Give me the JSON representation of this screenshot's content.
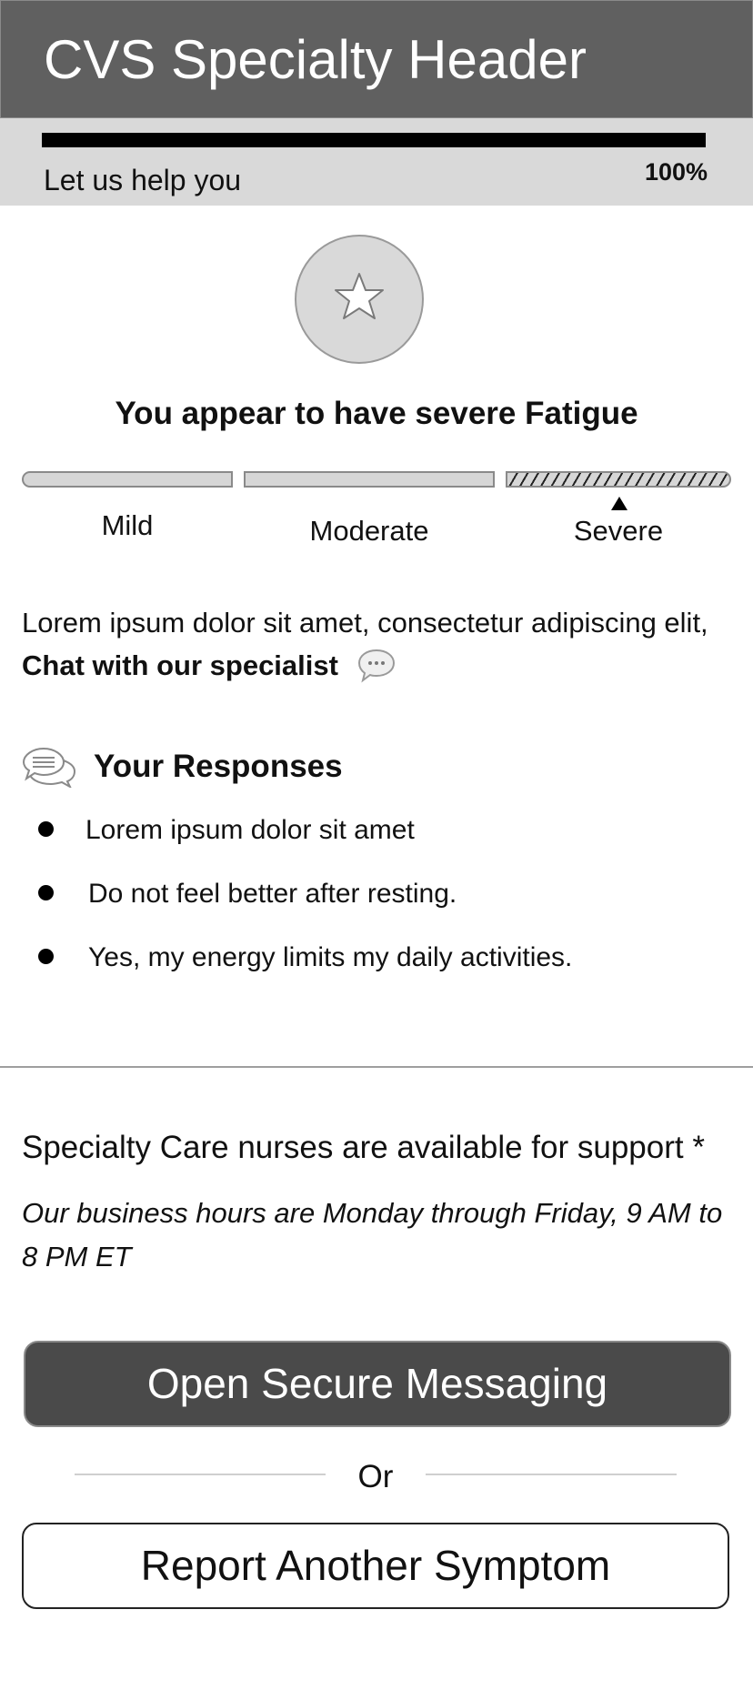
{
  "header": {
    "title": "CVS Specialty Header"
  },
  "progress": {
    "caption": "Let us help you",
    "percent_label": "100%",
    "value": 1.0
  },
  "result": {
    "icon": "star-icon",
    "title": "You appear to have severe Fatigue"
  },
  "severity_scale": {
    "levels": [
      "Mild",
      "Moderate",
      "Severe"
    ],
    "selected": "Severe"
  },
  "intro": {
    "text": "Lorem ipsum dolor sit amet, consectetur adipiscing elit,",
    "chat_link": "Chat with our specialist",
    "chat_icon": "chat-bubble-icon"
  },
  "responses": {
    "title": "Your Responses",
    "icon": "speech-bubbles-icon",
    "items": [
      "Lorem ipsum dolor sit amet",
      "Do not feel better after resting.",
      "Yes, my energy limits my daily activities."
    ]
  },
  "support": {
    "nurses_text": "Specialty Care nurses are available for support *",
    "hours_text": "Our business hours are Monday through Friday, 9 AM to 8 PM ET"
  },
  "actions": {
    "primary_label": "Open Secure Messaging",
    "or_label": "Or",
    "secondary_label": "Report Another Symptom"
  },
  "colors": {
    "header_bg": "#606060",
    "progress_bg": "#d9d9d9",
    "progress_fill": "#000000",
    "primary_button_bg": "#4a4a4a"
  }
}
